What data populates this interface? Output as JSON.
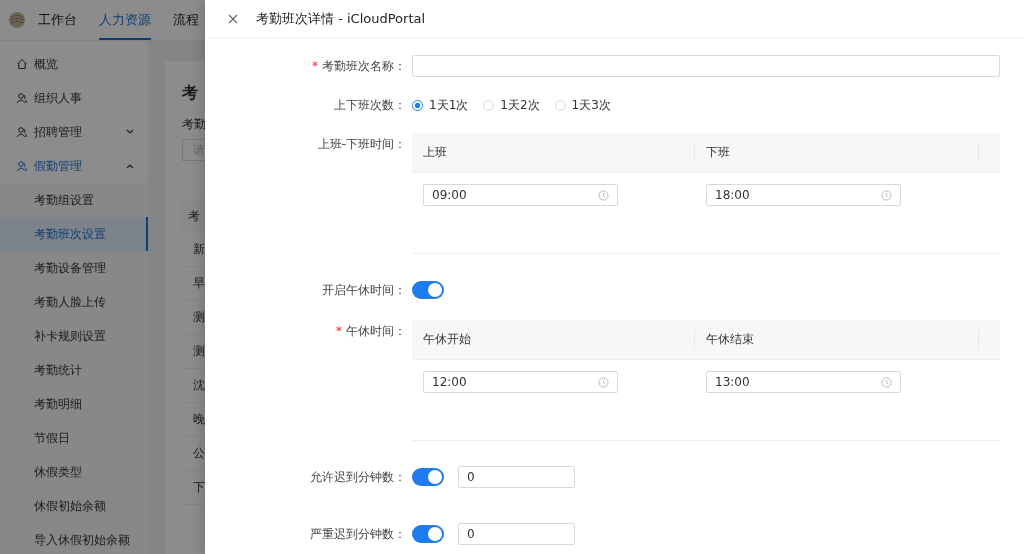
{
  "top_nav": {
    "tabs": [
      {
        "label": "工作台",
        "selected": false
      },
      {
        "label": "人力资源",
        "selected": true
      },
      {
        "label": "流程",
        "selected": false
      }
    ]
  },
  "sidebar": {
    "items": [
      {
        "label": "概览",
        "selected": false
      },
      {
        "label": "组织人事",
        "selected": false
      },
      {
        "label": "招聘管理",
        "expanded": false,
        "selected": false
      },
      {
        "label": "假勤管理",
        "expanded": true,
        "selected": true,
        "children": [
          {
            "label": "考勤组设置",
            "selected": false
          },
          {
            "label": "考勤班次设置",
            "selected": true
          },
          {
            "label": "考勤设备管理",
            "selected": false
          },
          {
            "label": "考勤人脸上传",
            "selected": false
          },
          {
            "label": "补卡规则设置",
            "selected": false
          },
          {
            "label": "考勤统计",
            "selected": false
          },
          {
            "label": "考勤明细",
            "selected": false
          },
          {
            "label": "节假日",
            "selected": false
          },
          {
            "label": "休假类型",
            "selected": false
          },
          {
            "label": "休假初始余额",
            "selected": false
          },
          {
            "label": "导入休假初始余额",
            "selected": false
          }
        ]
      }
    ]
  },
  "background_page": {
    "title": "考",
    "filter_label": "考勤",
    "filter_placeholder": "请",
    "table_header": "考",
    "rows": [
      "新",
      "早",
      "测",
      "测",
      "沈",
      "晚",
      "公",
      "下"
    ]
  },
  "drawer": {
    "title": "考勤班次详情 - iCloudPortal",
    "fields": [
      {
        "kind": "text",
        "required_mark": "*",
        "label": "考勤班次名称："
      },
      {
        "kind": "radio",
        "label": "上下班次数：",
        "options": [
          {
            "label": "1天1次",
            "selected": true
          },
          {
            "label": "1天2次",
            "selected": false
          },
          {
            "label": "1天3次",
            "selected": false
          }
        ]
      },
      {
        "kind": "time_table",
        "label": "上班-下班时间：",
        "columns": [
          {
            "header": "上班",
            "value": "09:00"
          },
          {
            "header": "下班",
            "value": "18:00"
          }
        ]
      },
      {
        "kind": "switch",
        "label": "开启午休时间：",
        "on": true
      },
      {
        "kind": "time_table",
        "required_mark": "*",
        "label": "午休时间：",
        "columns": [
          {
            "header": "午休开始",
            "value": "12:00"
          },
          {
            "header": "午休结束",
            "value": "13:00"
          }
        ]
      },
      {
        "kind": "switch_number",
        "label": "允许迟到分钟数：",
        "on": true,
        "value": "0"
      },
      {
        "kind": "switch_number",
        "label": "严重迟到分钟数：",
        "on": true,
        "value": "0"
      }
    ]
  }
}
